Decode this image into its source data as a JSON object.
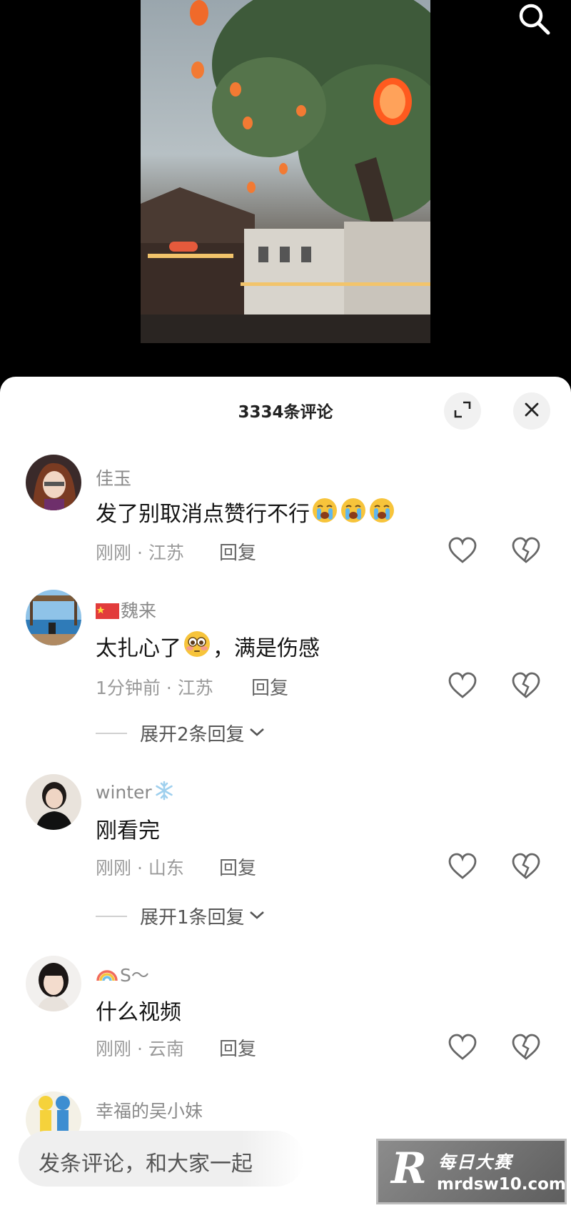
{
  "sheet": {
    "title": "3334条评论"
  },
  "comments": [
    {
      "user": "佳玉",
      "text": "发了别取消点赞行不行",
      "time": "刚刚",
      "location": "江苏",
      "reply_label": "回复"
    },
    {
      "user": "魏来",
      "text_before": "太扎心了",
      "text_after": "，满是伤感",
      "time": "1分钟前",
      "location": "江苏",
      "reply_label": "回复",
      "expand_label": "展开2条回复"
    },
    {
      "user": "winter",
      "text": "刚看完",
      "time": "刚刚",
      "location": "山东",
      "reply_label": "回复",
      "expand_label": "展开1条回复"
    },
    {
      "user": "S～",
      "text": "什么视频",
      "time": "刚刚",
      "location": "云南",
      "reply_label": "回复"
    },
    {
      "user": "幸福的吴小妹"
    }
  ],
  "separator": " · ",
  "input": {
    "placeholder": "发条评论，和大家一起"
  },
  "watermark": {
    "logo": "R",
    "name": "每日大赛",
    "domain": "mrdsw10.com"
  }
}
